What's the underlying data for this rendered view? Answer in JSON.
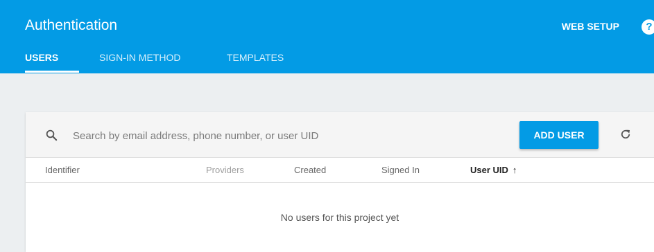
{
  "header": {
    "title": "Authentication",
    "web_setup_label": "WEB SETUP",
    "help_glyph": "?",
    "background_color": "#039be5"
  },
  "tabs": [
    {
      "label": "USERS",
      "active": true
    },
    {
      "label": "SIGN-IN METHOD",
      "active": false
    },
    {
      "label": "TEMPLATES",
      "active": false
    }
  ],
  "search": {
    "placeholder": "Search by email address, phone number, or user UID",
    "value": "",
    "icon": "search-icon"
  },
  "toolbar": {
    "add_user_label": "ADD USER",
    "refresh_icon": "refresh-icon"
  },
  "table": {
    "columns": [
      {
        "label": "Identifier"
      },
      {
        "label": "Providers"
      },
      {
        "label": "Created"
      },
      {
        "label": "Signed In"
      },
      {
        "label": "User UID",
        "sorted": "ascending",
        "sort_glyph": "↑"
      }
    ],
    "empty_message": "No users for this project yet"
  }
}
